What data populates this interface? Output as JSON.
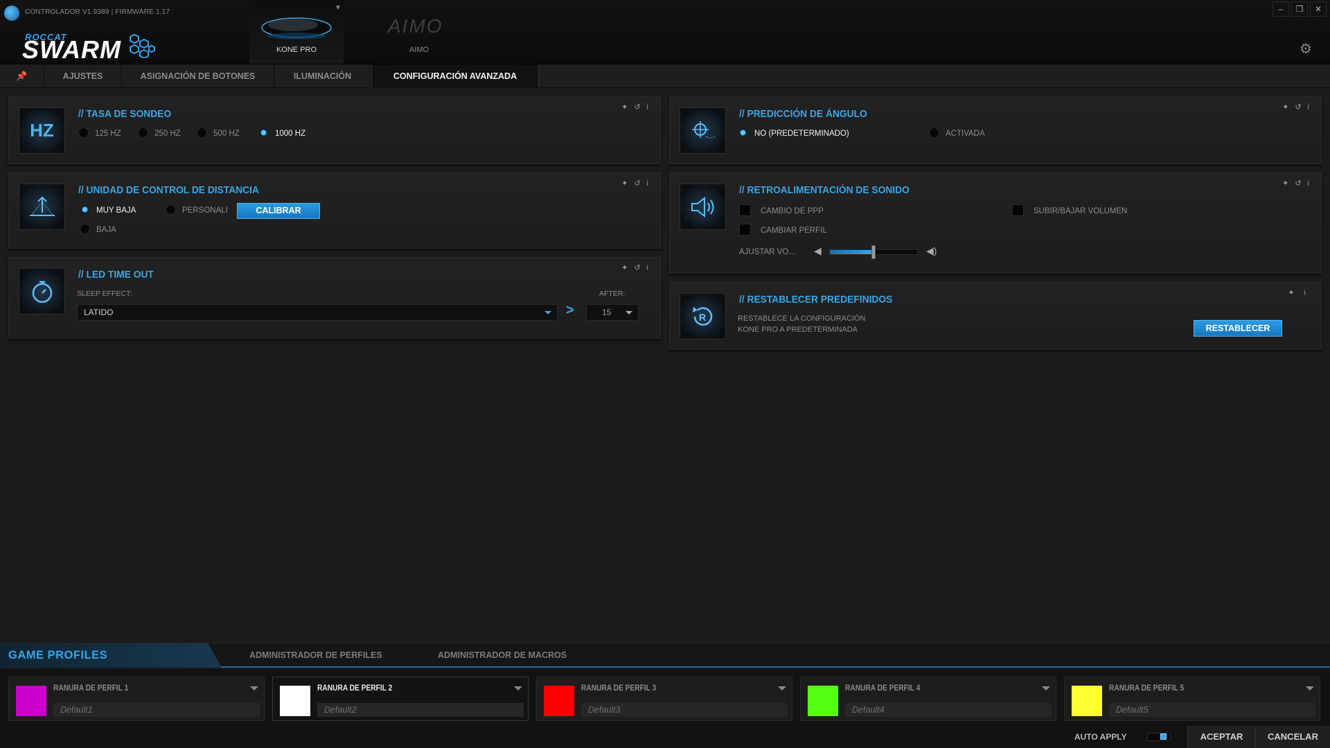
{
  "app": {
    "version": "CONTROLADOR V1.9389 | FIRMWARE 1.17",
    "logo_top": "ROCCAT",
    "logo_main": "SWARM"
  },
  "devices": [
    {
      "name": "KONE PRO",
      "active": true
    },
    {
      "name": "AIMO",
      "logo": "AIMO",
      "active": false
    }
  ],
  "window_controls": {
    "minimize": "–",
    "restore": "❐",
    "close": "✕"
  },
  "tabs": {
    "pin_icon": "📌",
    "items": [
      "AJUSTES",
      "ASIGNACIÓN DE BOTONES",
      "ILUMINACIÓN",
      "CONFIGURACIÓN AVANZADA"
    ],
    "active": "CONFIGURACIÓN AVANZADA"
  },
  "panels": {
    "polling": {
      "title": "// TASA DE SONDEO",
      "icon_text": "HZ",
      "options": [
        "125 HZ",
        "250 HZ",
        "500 HZ",
        "1000 HZ"
      ],
      "selected": "1000 HZ"
    },
    "angle": {
      "title": "// PREDICCIÓN DE ÁNGULO",
      "options": [
        "NO (PREDETERMINADO)",
        "ACTIVADA"
      ],
      "selected": "NO (PREDETERMINADO)"
    },
    "lift": {
      "title": "// UNIDAD DE CONTROL DE DISTANCIA",
      "options": [
        "MUY BAJA",
        "PERSONALI",
        "BAJA"
      ],
      "selected": "MUY BAJA",
      "calibrate_label": "CALIBRAR"
    },
    "sound": {
      "title": "// RETROALIMENTACIÓN DE SONIDO",
      "checks": [
        "CAMBIO DE PPP",
        "SUBIR/BAJAR VOLUMEN",
        "CAMBIAR PERFIL"
      ],
      "volume_label": "AJUSTAR VO...",
      "volume_level": 0.5
    },
    "led": {
      "title": "// LED TIME OUT",
      "sleep_label": "SLEEP EFFECT:",
      "sleep_value": "LATIDO",
      "after_label": "AFTER:",
      "after_value": "15",
      "arrow": ">"
    },
    "reset": {
      "title": "// RESTABLECER PREDEFINIDOS",
      "desc_line1": "RESTABLECE LA CONFIGURACIÓN",
      "desc_line2": "KONE PRO A PREDETERMINADA",
      "button": "RESTABLECER"
    }
  },
  "bottom": {
    "tabs": [
      "GAME PROFILES",
      "ADMINISTRADOR DE PERFILES",
      "ADMINISTRADOR DE MACROS"
    ],
    "profiles": [
      {
        "name": "RANURA DE PERFIL 1",
        "default": "Default1",
        "color": "#cc00cc"
      },
      {
        "name": "RANURA DE PERFIL 2",
        "default": "Default2",
        "color": "#ffffff"
      },
      {
        "name": "RANURA DE PERFIL 3",
        "default": "Default3",
        "color": "#ff0000"
      },
      {
        "name": "RANURA DE PERFIL 4",
        "default": "Default4",
        "color": "#55ff11"
      },
      {
        "name": "RANURA DE PERFIL 5",
        "default": "Default5",
        "color": "#ffff33"
      }
    ],
    "active_profile": 1,
    "auto_apply": "AUTO APPLY",
    "accept": "ACEPTAR",
    "cancel": "CANCELAR"
  },
  "colors": {
    "accent": "#3aa5e6",
    "background": "#1b1b1b"
  }
}
